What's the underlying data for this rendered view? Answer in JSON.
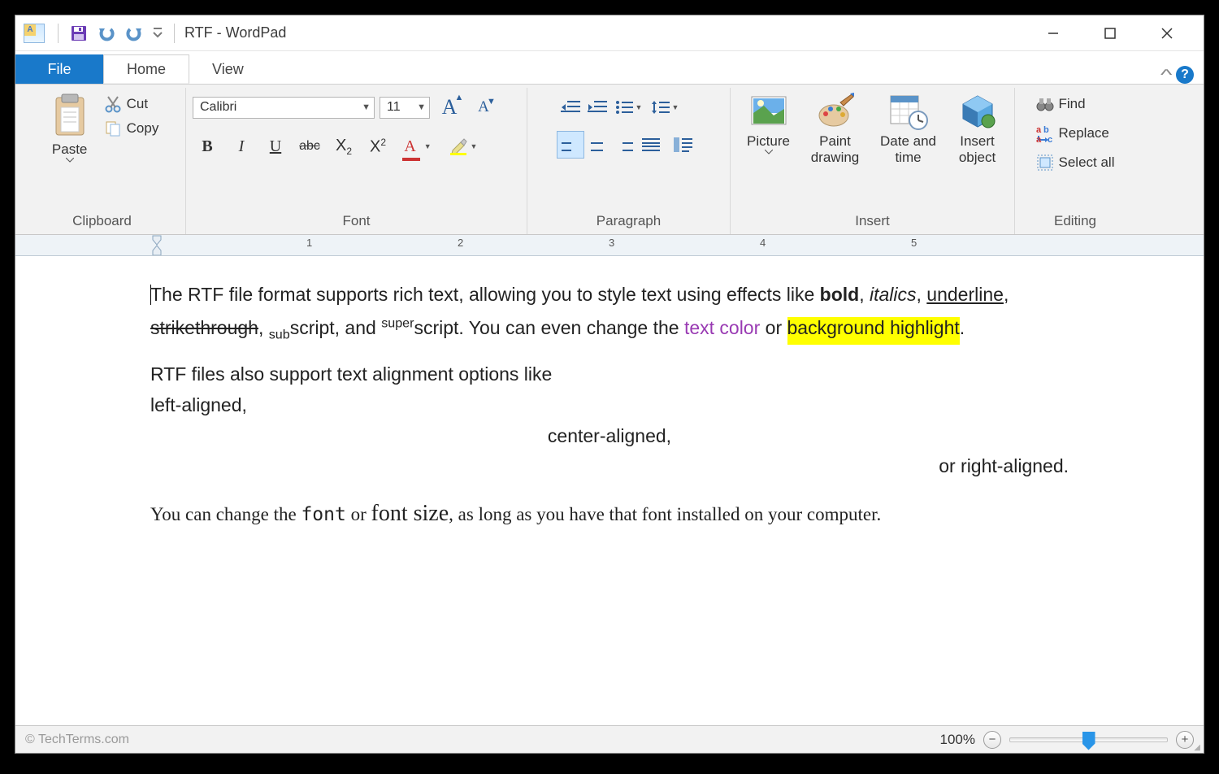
{
  "titlebar": {
    "title": "RTF - WordPad"
  },
  "tabs": {
    "file": "File",
    "home": "Home",
    "view": "View"
  },
  "ribbon": {
    "groups": {
      "clipboard": {
        "label": "Clipboard",
        "paste": "Paste",
        "cut": "Cut",
        "copy": "Copy"
      },
      "font": {
        "label": "Font",
        "family": "Calibri",
        "size": "11"
      },
      "paragraph": {
        "label": "Paragraph"
      },
      "insert": {
        "label": "Insert",
        "picture": "Picture",
        "paint": "Paint\ndrawing",
        "datetime": "Date and\ntime",
        "object": "Insert\nobject"
      },
      "editing": {
        "label": "Editing",
        "find": "Find",
        "replace": "Replace",
        "selectall": "Select all"
      }
    }
  },
  "ruler": {
    "numbers": [
      "1",
      "2",
      "3",
      "4",
      "5"
    ]
  },
  "doc": {
    "para1": {
      "a": "The RTF file format supports rich text, allowing you to style text using effects like ",
      "bold": "bold",
      "b": ", ",
      "ital": "italics",
      "c": ", ",
      "ul": "underline",
      "d": ", ",
      "strike": "strikethrough",
      "e": ", ",
      "sub": "sub",
      "f": "script, and ",
      "sup": "super",
      "g": "script. You can even change the ",
      "tc": "text color",
      "h": " or ",
      "hl": "background highlight",
      "i": "."
    },
    "align": {
      "intro": "RTF files also support text alignment options like",
      "left": "left-aligned,",
      "center": "center-aligned,",
      "right": "or right-aligned."
    },
    "para3": {
      "a": "You can change the ",
      "font": "font",
      "b": " or ",
      "size": "font size",
      "c": ", as long as you have that font installed on your computer."
    }
  },
  "statusbar": {
    "watermark": "© TechTerms.com",
    "zoom": "100%"
  }
}
